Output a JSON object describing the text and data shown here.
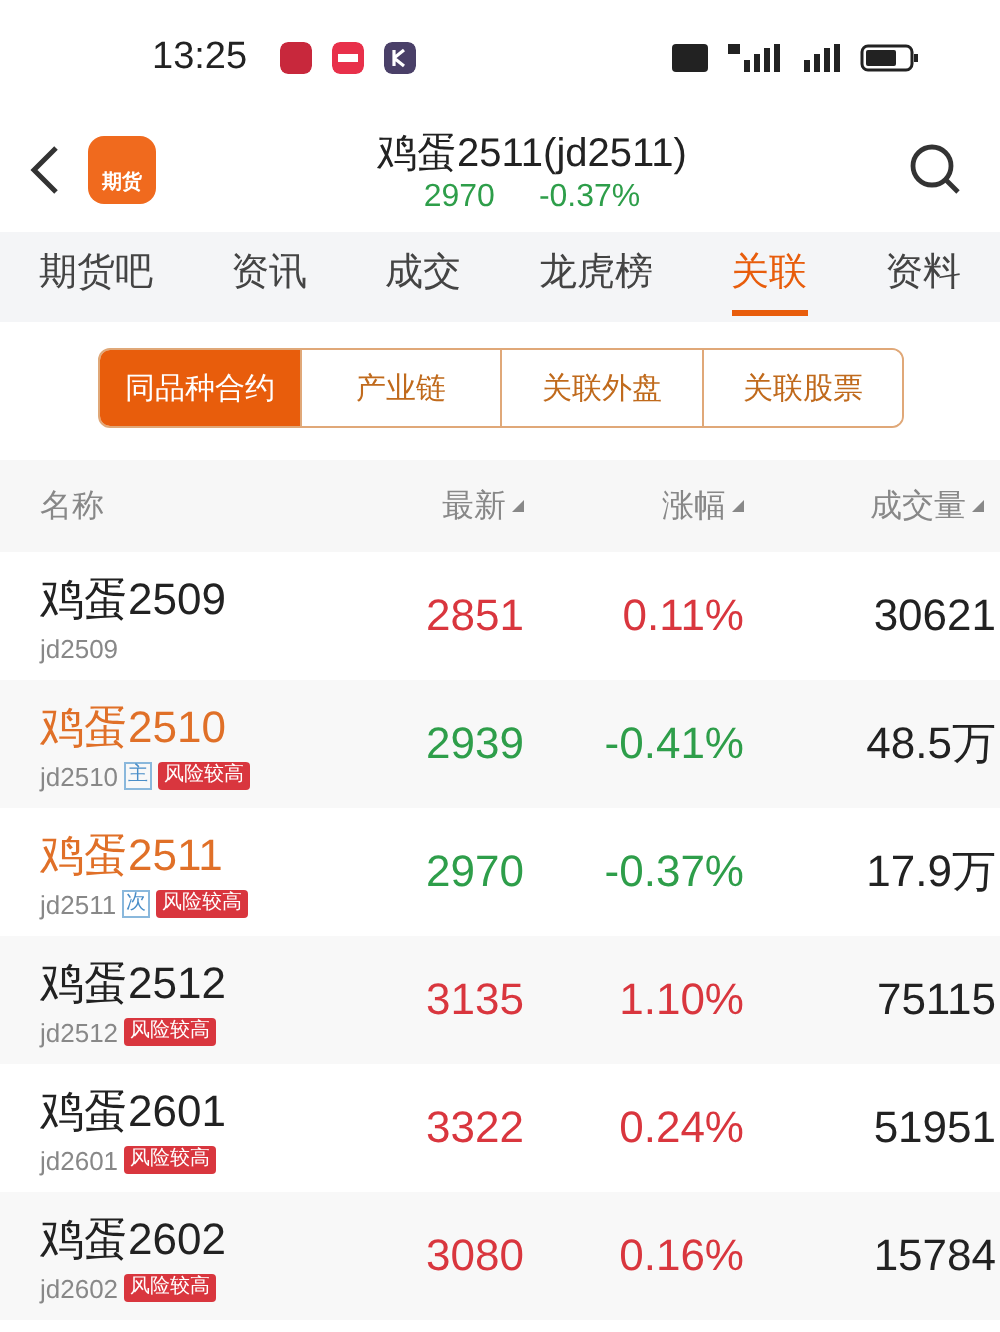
{
  "status_bar": {
    "time": "13:25"
  },
  "header": {
    "title": "鸡蛋2511(jd2511)",
    "price": "2970",
    "change": "-0.37%",
    "color": "#2e9e4a",
    "app_label": "期货"
  },
  "tabs": [
    {
      "label": "期货吧",
      "selected": false
    },
    {
      "label": "资讯",
      "selected": false
    },
    {
      "label": "成交",
      "selected": false
    },
    {
      "label": "龙虎榜",
      "selected": false
    },
    {
      "label": "关联",
      "selected": true
    },
    {
      "label": "资料",
      "selected": false
    }
  ],
  "segments": [
    {
      "label": "同品种合约",
      "selected": true
    },
    {
      "label": "产业链",
      "selected": false
    },
    {
      "label": "关联外盘",
      "selected": false
    },
    {
      "label": "关联股票",
      "selected": false
    }
  ],
  "table": {
    "columns": [
      {
        "label": "名称",
        "sortable": false
      },
      {
        "label": "最新",
        "sortable": true
      },
      {
        "label": "涨幅",
        "sortable": true
      },
      {
        "label": "成交量",
        "sortable": true
      }
    ],
    "rows": [
      {
        "name": "鸡蛋2509",
        "code": "jd2509",
        "highlighted": false,
        "tags": [],
        "price": "2851",
        "change": "0.11%",
        "color": "#d9363e",
        "volume": "30621"
      },
      {
        "name": "鸡蛋2510",
        "code": "jd2510",
        "highlighted": true,
        "tags": [
          {
            "kind": "outline",
            "label": "主"
          },
          {
            "kind": "risk",
            "label": "风险较高"
          }
        ],
        "price": "2939",
        "change": "-0.41%",
        "color": "#2e9e4a",
        "volume": "48.5万"
      },
      {
        "name": "鸡蛋2511",
        "code": "jd2511",
        "highlighted": true,
        "tags": [
          {
            "kind": "outline",
            "label": "次"
          },
          {
            "kind": "risk",
            "label": "风险较高"
          }
        ],
        "price": "2970",
        "change": "-0.37%",
        "color": "#2e9e4a",
        "volume": "17.9万"
      },
      {
        "name": "鸡蛋2512",
        "code": "jd2512",
        "highlighted": false,
        "tags": [
          {
            "kind": "risk",
            "label": "风险较高"
          }
        ],
        "price": "3135",
        "change": "1.10%",
        "color": "#d9363e",
        "volume": "75115"
      },
      {
        "name": "鸡蛋2601",
        "code": "jd2601",
        "highlighted": false,
        "tags": [
          {
            "kind": "risk",
            "label": "风险较高"
          }
        ],
        "price": "3322",
        "change": "0.24%",
        "color": "#d9363e",
        "volume": "51951"
      },
      {
        "name": "鸡蛋2602",
        "code": "jd2602",
        "highlighted": false,
        "tags": [
          {
            "kind": "risk",
            "label": "风险较高"
          }
        ],
        "price": "3080",
        "change": "0.16%",
        "color": "#d9363e",
        "volume": "15784"
      }
    ]
  }
}
